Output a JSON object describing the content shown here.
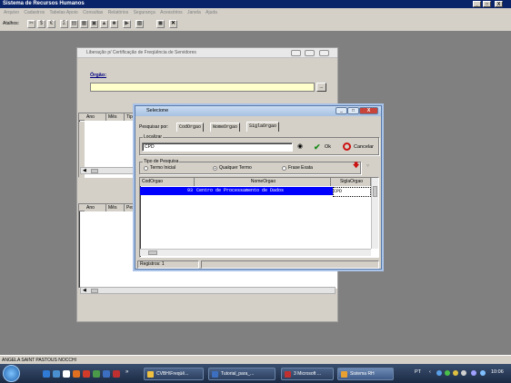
{
  "app": {
    "title": "Sistema de Recursos Humanos",
    "window_buttons": [
      "_",
      "□",
      "X"
    ]
  },
  "menu": [
    "Arquivo",
    "Cadastros",
    "Tabelas Apoio",
    "Consultas",
    "Relatórios",
    "Segurança",
    "Acessórios",
    "Janela",
    "Ajuda"
  ],
  "toolbar": {
    "label": "Atalhos:",
    "icons": [
      "cut-icon",
      "dollar-icon",
      "money-icon",
      "sigma-icon",
      "report-icon",
      "grid-icon",
      "building-icon",
      "chart-icon",
      "person-icon",
      "exit-icon",
      "close-icon"
    ]
  },
  "child_window": {
    "title": "Liberação p/ Certificação de Freqüência de Servidores",
    "orgao_label": "Órgão:",
    "orgao_value": "",
    "lookup_button": "...",
    "grid1_headers": [
      "Ano",
      "Mês",
      "Tipo"
    ],
    "grid2_headers": [
      "Ano",
      "Mês",
      "Peso"
    ]
  },
  "dialog": {
    "title": "Selecione",
    "search_by_label": "Pesquisar por:",
    "tabs": [
      "CodOrgao",
      "NomeOrgao",
      "SiglaOrgao"
    ],
    "active_tab": "SiglaOrgao",
    "locate_label": "Localizar",
    "search_value": "CPD",
    "ok_label": "Ok",
    "cancel_label": "Cancelar",
    "search_type_label": "Tipo de Pesquisa",
    "search_types": [
      "Termo Inicial",
      "Qualquer Termo",
      "Frase Exata"
    ],
    "selected_search_type": "Qualquer Termo",
    "columns": [
      "CodOrgao",
      "NomeOrgao",
      "SiglaOrgao"
    ],
    "rows": [
      {
        "cod": "93",
        "nome": "Centro de Processamento de Dados",
        "sigla": "CPD"
      }
    ],
    "records_label": "Registros: 1"
  },
  "status_bar": {
    "user": "ANGELA SAINT PASTOUS NOCCHI"
  },
  "taskbar": {
    "tasks": [
      "CVBH\\Freqüê...",
      "Tutorial_para_...",
      "3 Microsoft ...",
      "Sistema RH"
    ],
    "active_task": "Sistema RH",
    "language": "PT",
    "clock": "10:06"
  },
  "colors": {
    "title_bar": "#0a246a",
    "selection": "#0000ff",
    "input_yellow": "#ffffcc",
    "taskbar": "#1b2a44",
    "ok_green": "#1a8a1a",
    "cancel_red": "#cc1111"
  }
}
